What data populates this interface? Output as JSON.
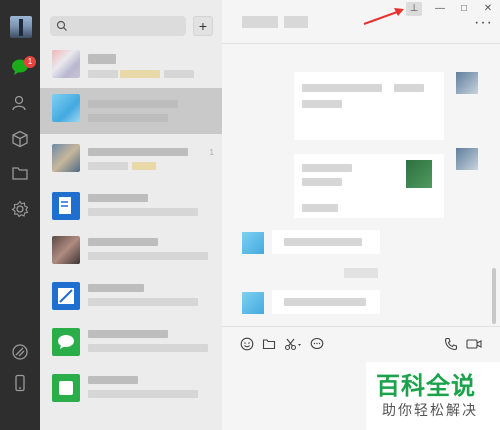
{
  "rail": {
    "unread_badge": "1",
    "icons": [
      "chat-icon",
      "contacts-icon",
      "box-icon",
      "folder-icon",
      "gear-icon",
      "moments-icon",
      "phone-icon"
    ]
  },
  "search": {
    "placeholder": ""
  },
  "list": {
    "add_label": "+",
    "items": [
      {
        "time": ""
      },
      {
        "time": ""
      },
      {
        "time": "1"
      },
      {
        "time": ""
      },
      {
        "time": ""
      },
      {
        "time": ""
      },
      {
        "time": ""
      },
      {
        "time": ""
      }
    ]
  },
  "conversation": {
    "more_label": "···",
    "input_placeholder": ""
  },
  "window": {
    "pin_label": "⊥",
    "minimize_label": "—",
    "maximize_label": "□",
    "close_label": "✕"
  },
  "watermark": {
    "title": "百科全说",
    "subtitle": "助你轻松解决"
  },
  "colors": {
    "rail_bg": "#2e2e2e",
    "list_bg": "#ececec",
    "selected": "#c9c9c9",
    "badge": "#e64340",
    "brand_green": "#1aa34a",
    "arrow_red": "#e5322d"
  }
}
